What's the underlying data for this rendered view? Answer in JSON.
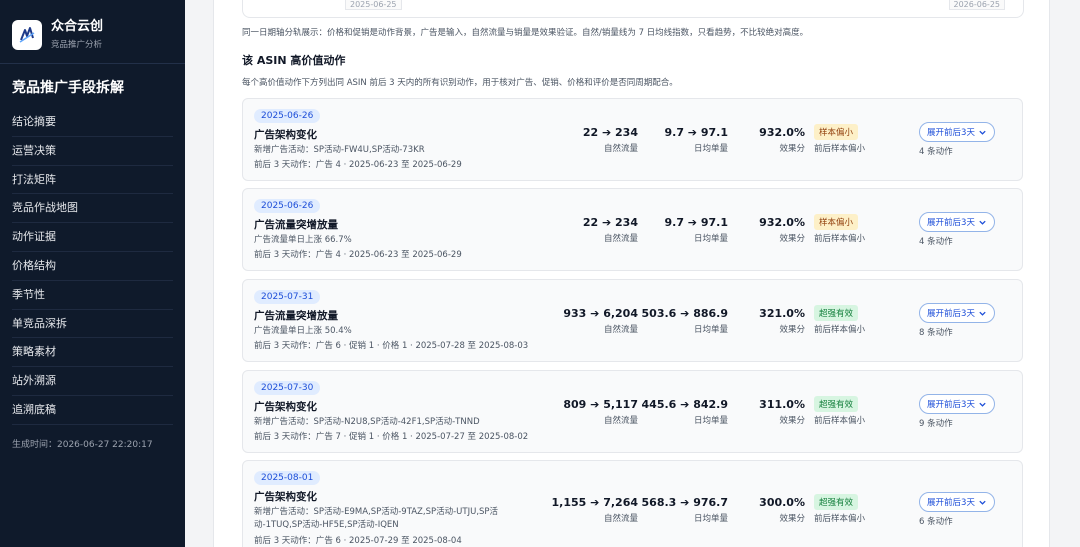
{
  "sidebar": {
    "brand_name": "众合云创",
    "brand_sub": "竞品推广分析",
    "title": "竞品推广手段拆解",
    "items": [
      "结论摘要",
      "运营决策",
      "打法矩阵",
      "竞品作战地图",
      "动作证据",
      "价格结构",
      "季节性",
      "单竞品深拆",
      "策略素材",
      "站外溯源",
      "追溯底稿"
    ],
    "generated_time": "生成时间：2026-06-27 22:20:17"
  },
  "main": {
    "chart_stub": {
      "start_date": "2025-06-25",
      "end_date": "2026-06-25"
    },
    "note": "同一日期轴分轨展示：价格和促销是动作背景，广告是输入，自然流量与销量是效果验证。自然/销量线为 7 日均线指数，只看趋势，不比较绝对高度。",
    "section_title": "该 ASIN 高价值动作",
    "section_desc": "每个高价值动作下方列出同 ASIN 前后 3 天内的所有识别动作，用于核对广告、促销、价格和评价是否同周期配合。",
    "labels": {
      "natural": "自然流量",
      "daily": "日均单量",
      "effect": "效果分",
      "expand": "展开前后3天"
    },
    "cards": [
      {
        "date": "2025-06-26",
        "title": "广告架构变化",
        "sub": "新增广告活动：SP活动-FW4U,SP活动-73KR",
        "foot": "前后 3 天动作：广告 4 · 2025-06-23 至 2025-06-29",
        "natural": "22 ➔ 234",
        "daily": "9.7 ➔ 97.1",
        "effect": "932.0%",
        "badge": "样本偏小",
        "badge_type": "warn",
        "badge_note": "前后样本偏小",
        "count": "4 条动作"
      },
      {
        "date": "2025-06-26",
        "title": "广告流量突增放量",
        "sub": "广告流量单日上涨 66.7%",
        "foot": "前后 3 天动作：广告 4 · 2025-06-23 至 2025-06-29",
        "natural": "22 ➔ 234",
        "daily": "9.7 ➔ 97.1",
        "effect": "932.0%",
        "badge": "样本偏小",
        "badge_type": "warn",
        "badge_note": "前后样本偏小",
        "count": "4 条动作"
      },
      {
        "date": "2025-07-31",
        "title": "广告流量突增放量",
        "sub": "广告流量单日上涨 50.4%",
        "foot": "前后 3 天动作：广告 6 · 促销 1 · 价格 1 · 2025-07-28 至 2025-08-03",
        "natural": "933 ➔ 6,204",
        "daily": "503.6 ➔ 886.9",
        "effect": "321.0%",
        "badge": "超强有效",
        "badge_type": "good",
        "badge_note": "前后样本偏小",
        "count": "8 条动作"
      },
      {
        "date": "2025-07-30",
        "title": "广告架构变化",
        "sub": "新增广告活动：SP活动-N2U8,SP活动-42F1,SP活动-TNND",
        "foot": "前后 3 天动作：广告 7 · 促销 1 · 价格 1 · 2025-07-27 至 2025-08-02",
        "natural": "809 ➔ 5,117",
        "daily": "445.6 ➔ 842.9",
        "effect": "311.0%",
        "badge": "超强有效",
        "badge_type": "good",
        "badge_note": "前后样本偏小",
        "count": "9 条动作"
      },
      {
        "date": "2025-08-01",
        "title": "广告架构变化",
        "sub": "新增广告活动：SP活动-E9MA,SP活动-9TAZ,SP活动-UTJU,SP活动-1TUQ,SP活动-HF5E,SP活动-IQEN",
        "foot": "前后 3 天动作：广告 6 · 2025-07-29 至 2025-08-04",
        "natural": "1,155 ➔ 7,264",
        "daily": "568.3 ➔ 976.7",
        "effect": "300.0%",
        "badge": "超强有效",
        "badge_type": "good",
        "badge_note": "前后样本偏小",
        "count": "6 条动作"
      }
    ]
  }
}
